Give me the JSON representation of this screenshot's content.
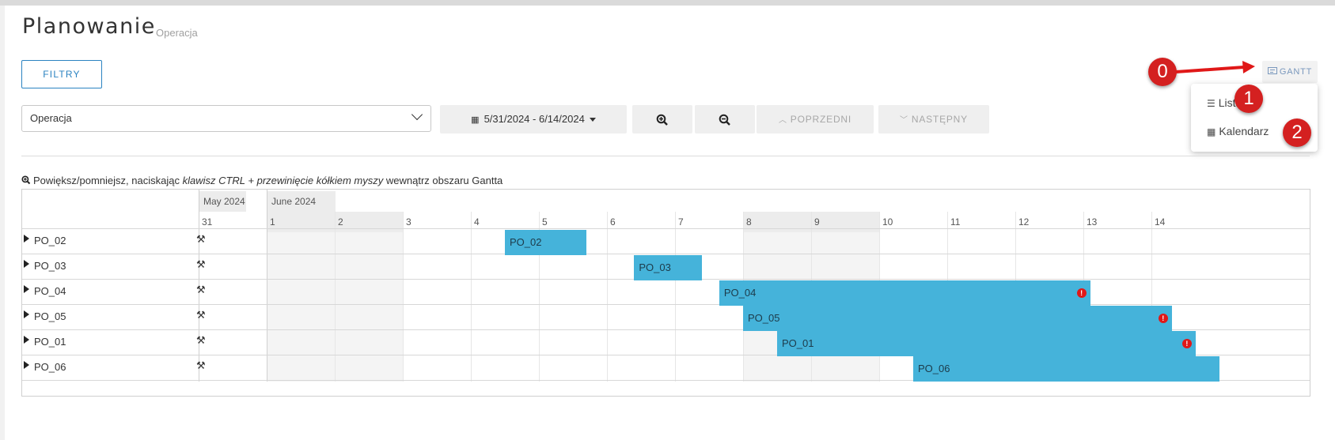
{
  "page": {
    "title": "Planowanie",
    "subtitle": "Operacja"
  },
  "toolbar": {
    "filters_label": "FILTRY",
    "view_button_label": "GANTT",
    "select_value": "Operacja",
    "date_range": "5/31/2024 - 6/14/2024",
    "prev_label": "POPRZEDNI",
    "next_label": "NASTĘPNY",
    "zoom_in_icon": "zoom-in-icon",
    "zoom_out_icon": "zoom-out-icon"
  },
  "view_menu": {
    "items": [
      {
        "label": "Lista",
        "icon": "list-icon"
      },
      {
        "label": "Kalendarz",
        "icon": "calendar-icon"
      }
    ]
  },
  "annotations": {
    "badges": [
      "0",
      "1",
      "2"
    ],
    "color": "#d42020"
  },
  "hint": {
    "before": "Powiększ/pomniejsz, naciskając ",
    "italic": "klawisz CTRL + przewinięcie kółkiem myszy",
    "after": " wewnątrz obszaru Gantta"
  },
  "gantt": {
    "months": [
      "May 2024",
      "June 2024"
    ],
    "days": [
      "31",
      "1",
      "2",
      "3",
      "4",
      "5",
      "6",
      "7",
      "8",
      "9",
      "10",
      "11",
      "12",
      "13",
      "14"
    ],
    "weekend_days": [
      "1",
      "2",
      "8",
      "9"
    ],
    "bar_color": "#45b3da",
    "rows": [
      {
        "name": "PO_02",
        "bar_label": "PO_02",
        "start_day": 4.5,
        "end_day": 5.7,
        "warning": false
      },
      {
        "name": "PO_03",
        "bar_label": "PO_03",
        "start_day": 6.4,
        "end_day": 7.4,
        "warning": false
      },
      {
        "name": "PO_04",
        "bar_label": "PO_04",
        "start_day": 7.65,
        "end_day": 13.1,
        "warning": true
      },
      {
        "name": "PO_05",
        "bar_label": "PO_05",
        "start_day": 8.0,
        "end_day": 14.3,
        "warning": true
      },
      {
        "name": "PO_01",
        "bar_label": "PO_01",
        "start_day": 8.5,
        "end_day": 14.65,
        "warning": true
      },
      {
        "name": "PO_06",
        "bar_label": "PO_06",
        "start_day": 10.5,
        "end_day": 15.0,
        "warning": false
      }
    ]
  }
}
